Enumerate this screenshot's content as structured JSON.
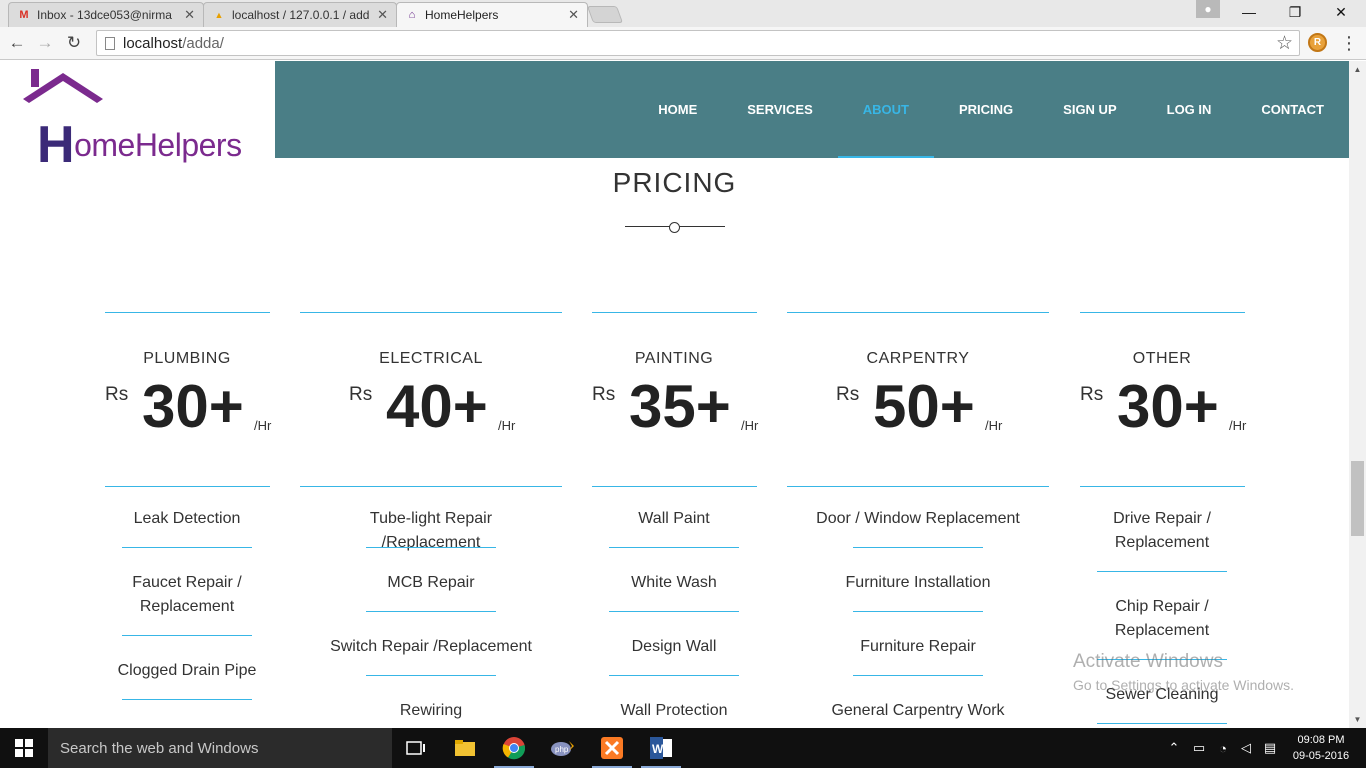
{
  "browser": {
    "tabs": [
      {
        "title": "Inbox - 13dce053@nirma",
        "icon": "gmail-icon",
        "active": false
      },
      {
        "title": "localhost / 127.0.0.1 / add",
        "icon": "phpmyadmin-icon",
        "active": false
      },
      {
        "title": "HomeHelpers",
        "icon": "homehelpers-icon",
        "active": true
      }
    ],
    "url_host": "localhost",
    "url_path": "/adda/"
  },
  "site": {
    "logo_h": "H",
    "logo_rest": "omeHelpers",
    "nav": [
      {
        "label": "HOME",
        "active": false
      },
      {
        "label": "SERVICES",
        "active": false
      },
      {
        "label": "ABOUT",
        "active": true
      },
      {
        "label": "PRICING",
        "active": false
      },
      {
        "label": "SIGN UP",
        "active": false
      },
      {
        "label": "LOG IN",
        "active": false
      },
      {
        "label": "CONTACT",
        "active": false
      }
    ],
    "accent_color": "#38b6e6",
    "header_color": "#4a7e86"
  },
  "pricing": {
    "title": "PRICING",
    "currency": "Rs",
    "unit": "/Hr",
    "plans": [
      {
        "category": "PLUMBING",
        "price": "30+",
        "features": [
          "Leak Detection",
          "Faucet Repair / Replacement",
          "Clogged Drain Pipe"
        ]
      },
      {
        "category": "ELECTRICAL",
        "price": "40+",
        "features": [
          "Tube-light Repair /Replacement",
          "MCB Repair",
          "Switch Repair /Replacement",
          "Rewiring"
        ]
      },
      {
        "category": "PAINTING",
        "price": "35+",
        "features": [
          "Wall Paint",
          "White Wash",
          "Design Wall",
          "Wall Protection"
        ]
      },
      {
        "category": "CARPENTRY",
        "price": "50+",
        "features": [
          "Door / Window Replacement",
          "Furniture Installation",
          "Furniture Repair",
          "General Carpentry Work"
        ]
      },
      {
        "category": "OTHER",
        "price": "30+",
        "features": [
          "Drive Repair / Replacement",
          "Chip Repair / Replacement",
          "Sewer Cleaning"
        ]
      }
    ]
  },
  "watermark": {
    "line1": "Activate Windows",
    "line2": "Go to Settings to activate Windows."
  },
  "taskbar": {
    "search_placeholder": "Search the web and Windows",
    "time": "09:08 PM",
    "date": "09-05-2016"
  }
}
